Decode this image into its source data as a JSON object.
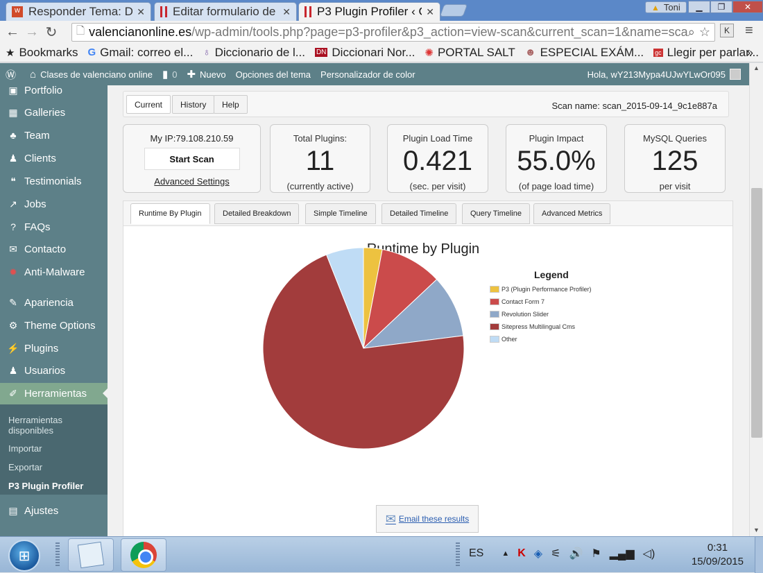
{
  "browser": {
    "tabs": [
      {
        "title": "Responder Tema: Du",
        "color": "#d04a2a"
      },
      {
        "title": "Editar formulario de",
        "color": "#c8262e"
      },
      {
        "title": "P3 Plugin Profiler ‹ C",
        "color": "#c8262e"
      }
    ],
    "user": "Toni",
    "url_host": "valencianonline.es",
    "url_path": "/wp-admin/tools.php?page=p3-profiler&p3_action=view-scan&current_scan=1&name=scan_",
    "ext_label": "K",
    "bookmarks": [
      "Bookmarks",
      "Gmail: correo el...",
      "Diccionario de l...",
      "Diccionari Nor...",
      "PORTAL SALT",
      "ESPECIAL EXÁM...",
      "Llegir per parlar..."
    ],
    "bookmarks_more": "»"
  },
  "adminbar": {
    "site": "Clases de valenciano online",
    "comments": "0",
    "new": "Nuevo",
    "theme_options": "Opciones del tema",
    "color": "Personalizador de color",
    "greeting": "Hola, wY213Mypa4UJwYLwOr095"
  },
  "sidebar": {
    "items": [
      "Portfolio",
      "Galleries",
      "Team",
      "Clients",
      "Testimonials",
      "Jobs",
      "FAQs",
      "Contacto",
      "Anti-Malware",
      "Apariencia",
      "Theme Options",
      "Plugins",
      "Usuarios",
      "Herramientas",
      "Ajustes"
    ],
    "submenu": [
      "Herramientas disponibles",
      "Importar",
      "Exportar",
      "P3 Plugin Profiler"
    ]
  },
  "topnav": {
    "tabs": [
      "Current",
      "History",
      "Help"
    ],
    "scan_name": "Scan name: scan_2015-09-14_9c1e887a"
  },
  "stats": {
    "ip": "My IP:79.108.210.59",
    "start_scan": "Start Scan",
    "advanced": "Advanced Settings",
    "cards": [
      {
        "label": "Total Plugins:",
        "value": "11",
        "note": "(currently active)"
      },
      {
        "label": "Plugin Load Time",
        "value": "0.421",
        "note": "(sec. per visit)"
      },
      {
        "label": "Plugin Impact",
        "value": "55.0%",
        "note": "(of page load time)"
      },
      {
        "label": "MySQL Queries",
        "value": "125",
        "note": "per visit"
      }
    ]
  },
  "subtabs": [
    "Runtime By Plugin",
    "Detailed Breakdown",
    "Simple Timeline",
    "Detailed Timeline",
    "Query Timeline",
    "Advanced Metrics"
  ],
  "email": "Email these results",
  "taskbar": {
    "lang": "ES",
    "time": "0:31",
    "date": "15/09/2015"
  },
  "chart_data": {
    "type": "pie",
    "title": "Runtime by Plugin",
    "legend_title": "Legend",
    "legend_position": "right",
    "series": [
      {
        "name": "P3 (Plugin Performance Profiler)",
        "value": 3,
        "color": "#edc240"
      },
      {
        "name": "Contact Form 7",
        "value": 10,
        "color": "#cb4b4b"
      },
      {
        "name": "Revolution Slider",
        "value": 10,
        "color": "#8fa8c8"
      },
      {
        "name": "Sitepress Multilingual Cms",
        "value": 71,
        "color": "#a23c3c"
      },
      {
        "name": "Other",
        "value": 6,
        "color": "#bfdcf5"
      }
    ]
  }
}
